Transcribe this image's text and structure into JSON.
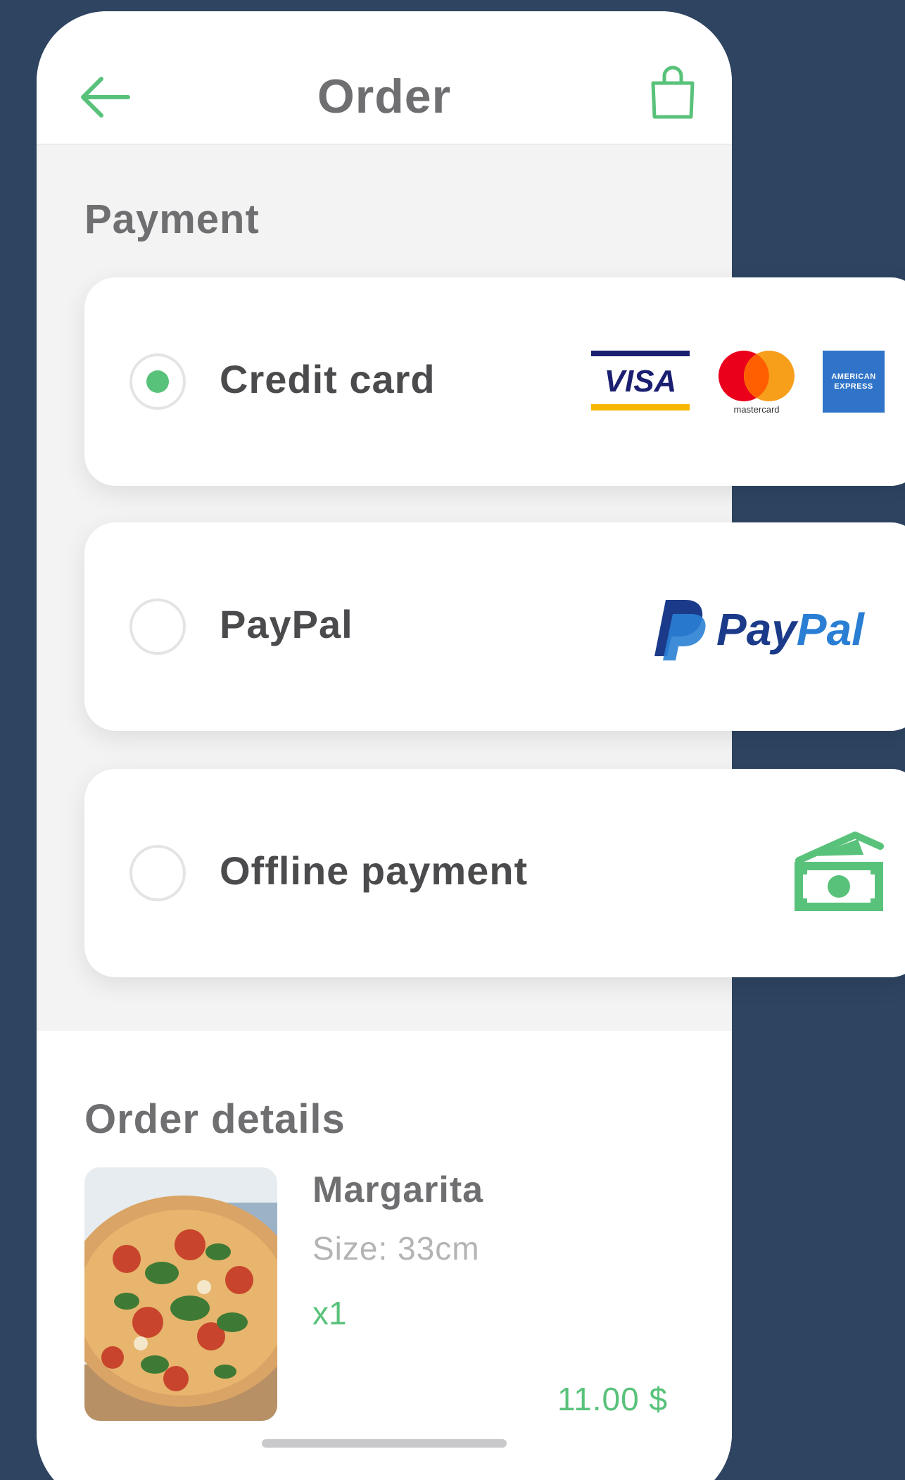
{
  "header": {
    "title": "Order",
    "back_icon": "arrow-left-icon",
    "bag_icon": "shopping-bag-icon"
  },
  "payment": {
    "section_title": "Payment",
    "options": [
      {
        "label": "Credit card",
        "selected": true,
        "logos": [
          "visa",
          "mastercard",
          "american-express"
        ]
      },
      {
        "label": "PayPal",
        "selected": false,
        "logos": [
          "paypal"
        ]
      },
      {
        "label": "Offline payment",
        "selected": false,
        "logos": [
          "cash-icon"
        ]
      }
    ],
    "visa_text": "VISA",
    "mastercard_text": "mastercard",
    "amex_text_line1": "AMERICAN",
    "amex_text_line2": "EXPRESS",
    "paypal_text": "PayPal"
  },
  "order_details": {
    "section_title": "Order details",
    "item": {
      "name": "Margarita",
      "size": "Size: 33cm",
      "quantity": "x1",
      "price": "11.00 $"
    }
  },
  "colors": {
    "background": "#2e4461",
    "accent_green": "#59c27a",
    "paypal_dark": "#1b3b8a",
    "paypal_light": "#2a7fd4"
  }
}
